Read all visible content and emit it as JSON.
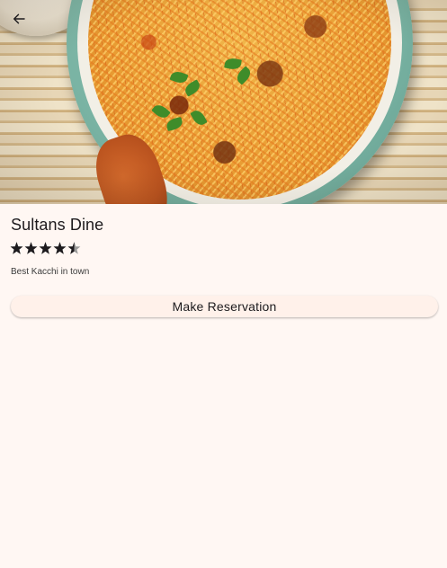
{
  "header": {
    "back_icon": "arrow-left-icon"
  },
  "hero": {
    "image": "biryani-bowl-photo"
  },
  "restaurant": {
    "name": "Sultans Dine",
    "rating": 4.5,
    "rating_max": 5,
    "description": "Best Kacchi in town"
  },
  "actions": {
    "reserve_label": "Make Reservation"
  },
  "colors": {
    "background": "#fff7f3",
    "button_background": "#fff1ea",
    "text": "#1d1b1e",
    "star": "#1d1b1e"
  }
}
